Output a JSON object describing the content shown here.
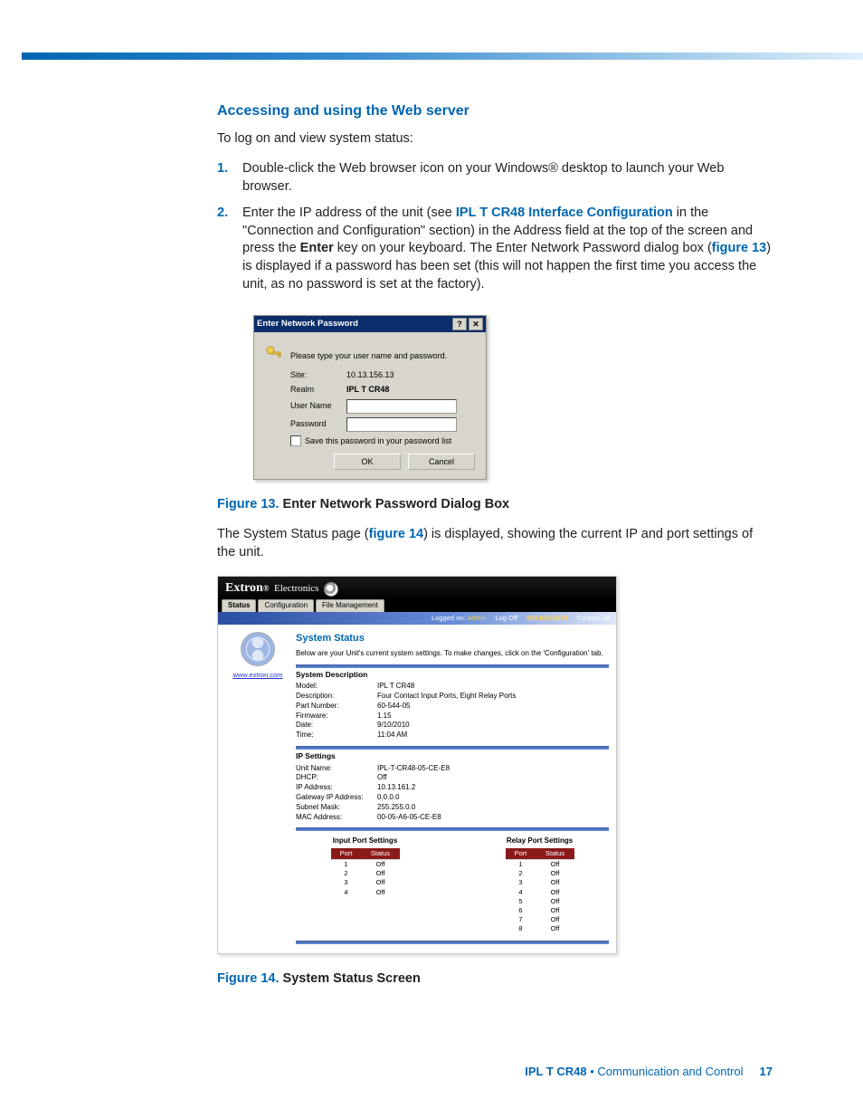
{
  "heading": "Accessing and using the Web server",
  "lead": "To log on and view system status:",
  "step1": "Double-click the Web browser icon on your Windows® desktop to launch your Web browser.",
  "step2_a": "Enter the IP address of the unit (see ",
  "step2_link1": "IPL T CR48 Interface Configuration",
  "step2_b": " in the \"Connection and Configuration\" section) in the Address field at the top of the screen and press the ",
  "step2_bold": "Enter",
  "step2_c": " key on your keyboard. The Enter Network Password dialog box (",
  "step2_link2": "figure 13",
  "step2_d": ") is displayed if a password has been set (this will not happen the first time you access the unit, as no password is set at the factory).",
  "num1": "1.",
  "num2": "2.",
  "dlg": {
    "title": "Enter Network Password",
    "help": "?",
    "close": "✕",
    "prompt": "Please type your user name and password.",
    "site_lbl": "Site:",
    "site_val": "10.13.156.13",
    "realm_lbl": "Realm",
    "realm_val": "IPL T CR48",
    "user_lbl": "User Name",
    "pass_lbl": "Password",
    "save_lbl": "Save this password in your password list",
    "ok": "OK",
    "cancel": "Cancel"
  },
  "fig13_lbl": "Figure 13. ",
  "fig13_txt": "Enter Network Password Dialog Box",
  "mid_a": "The System Status page (",
  "mid_link": "figure 14",
  "mid_b": ") is displayed, showing the current IP and port settings of the unit.",
  "ss": {
    "brand": "Extron",
    "brand2": "Electronics",
    "tabs": {
      "t0": "Status",
      "t1": "Configuration",
      "t2": "File Management"
    },
    "bar_login_lbl": "Logged on:",
    "bar_login_val": "Admin",
    "bar_logoff": "Log Off",
    "bar_phone": "800.633.9876",
    "bar_contact": "Contact Us",
    "left_link": "www.extron.com",
    "title": "System Status",
    "subtitle": "Below are your Unit's current system settings. To make changes, click on the 'Configuration' tab.",
    "sect1": "System Description",
    "kv1": {
      "model_k": "Model:",
      "model_v": "IPL T CR48",
      "desc_k": "Description:",
      "desc_v": "Four Contact Input Ports, Eight Relay Ports",
      "part_k": "Part Number:",
      "part_v": "60-544-05",
      "fw_k": "Firmware:",
      "fw_v": "1.15",
      "date_k": "Date:",
      "date_v": "9/10/2010",
      "time_k": "Time:",
      "time_v": "11:04 AM"
    },
    "sect2": "IP Settings",
    "kv2": {
      "unit_k": "Unit Name:",
      "unit_v": "IPL-T-CR48-05-CE-E8",
      "dhcp_k": "DHCP:",
      "dhcp_v": "Off",
      "ip_k": "IP Address:",
      "ip_v": "10.13.161.2",
      "gw_k": "Gateway IP Address:",
      "gw_v": "0.0.0.0",
      "sm_k": "Subnet Mask:",
      "sm_v": "255.255.0.0",
      "mac_k": "MAC Address:",
      "mac_v": "00-05-A6-05-CE-E8"
    },
    "input_hdr": "Input Port Settings",
    "relay_hdr": "Relay Port Settings",
    "col_port": "Port",
    "col_status": "Status",
    "in_ports": {
      "p1": "1",
      "s1": "Off",
      "p2": "2",
      "s2": "Off",
      "p3": "3",
      "s3": "Off",
      "p4": "4",
      "s4": "Off"
    },
    "rl_ports": {
      "p1": "1",
      "s1": "Off",
      "p2": "2",
      "s2": "Off",
      "p3": "3",
      "s3": "Off",
      "p4": "4",
      "s4": "Off",
      "p5": "5",
      "s5": "Off",
      "p6": "6",
      "s6": "Off",
      "p7": "7",
      "s7": "Off",
      "p8": "8",
      "s8": "Off"
    }
  },
  "fig14_lbl": "Figure 14. ",
  "fig14_txt": "System Status Screen",
  "footer": {
    "product": "IPL T CR48",
    "dot": " • ",
    "section": "Communication and Control",
    "page": "17"
  }
}
